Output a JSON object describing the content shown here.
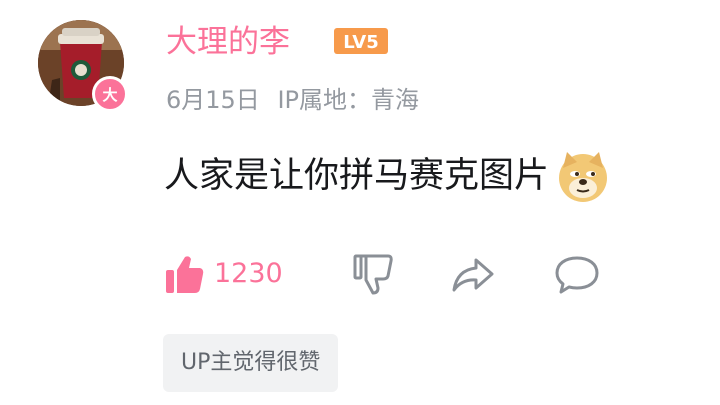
{
  "comment": {
    "username": "大理的李",
    "level": "LV5",
    "avatar_badge": "大",
    "date": "6月15日",
    "ip_location": "IP属地：青海",
    "text": "人家是让你拼马赛克图片",
    "emoji": "doge-icon",
    "like_count": "1230",
    "up_tag": "UP主觉得很赞"
  },
  "colors": {
    "accent": "#fb7299",
    "level_badge": "#f79a4b",
    "meta_text": "#9499a0",
    "body_text": "#18191c",
    "tag_bg": "#f1f2f3"
  }
}
